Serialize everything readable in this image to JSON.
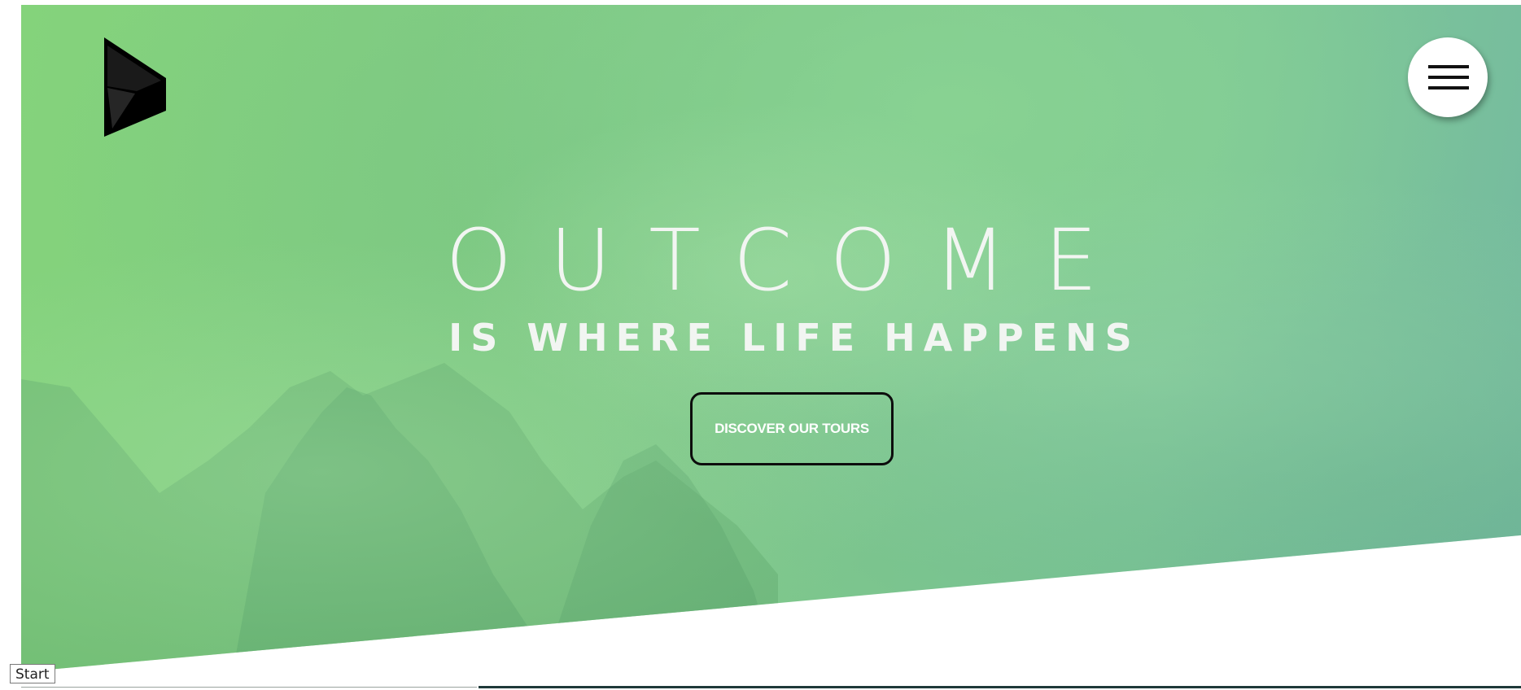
{
  "hero": {
    "title": "OUTCOME",
    "subtitle": "IS WHERE LIFE HAPPENS",
    "cta_label": "DISCOVER OUR TOURS"
  },
  "header": {
    "logo_icon": "play-triangle-logo-icon",
    "menu_icon": "hamburger-menu-icon"
  },
  "overlay": {
    "tooltip_text": "Start"
  },
  "colors": {
    "hero_green": "#80c988",
    "text_white": "#f2f5f2",
    "button_border": "#0d0d0d"
  }
}
